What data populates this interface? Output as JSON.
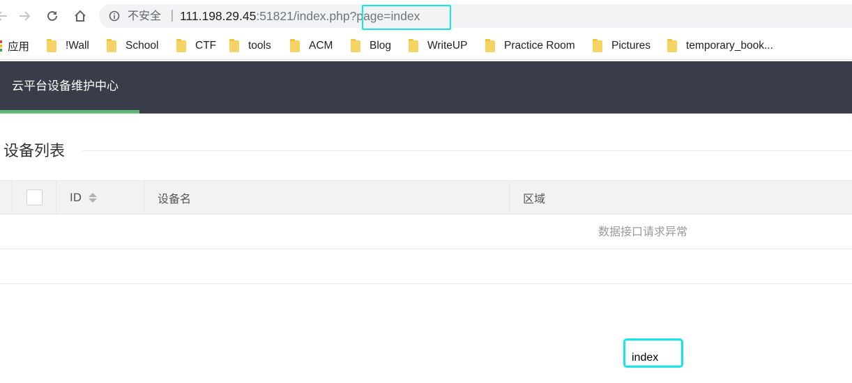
{
  "browser": {
    "security_label": "不安全",
    "url_separator": "|",
    "url_host": "111.198.29.45",
    "url_rest": ":51821/index.php?page=index"
  },
  "bookmarks": {
    "apps_label": "应用",
    "items": [
      {
        "label": "!Wall",
        "icon": "folder-icon"
      },
      {
        "label": "School",
        "icon": "folder-icon"
      },
      {
        "label": "CTF",
        "icon": "folder-icon"
      },
      {
        "label": "tools",
        "icon": "folder-icon"
      },
      {
        "label": "ACM",
        "icon": "folder-icon"
      },
      {
        "label": "Blog",
        "icon": "folder-icon"
      },
      {
        "label": "WriteUP",
        "icon": "folder-icon"
      },
      {
        "label": "Practice Room",
        "icon": "folder-icon"
      },
      {
        "label": "Pictures",
        "icon": "folder-icon"
      },
      {
        "label": "temporary_book...",
        "icon": "folder-icon"
      }
    ]
  },
  "app": {
    "title": "云平台设备维护中心",
    "header_bg": "#393d49",
    "accent": "#5fb878"
  },
  "main": {
    "section_title": "设备列表",
    "table": {
      "columns": [
        "ID",
        "设备名",
        "区域"
      ],
      "empty_message": "数据接口请求异常"
    },
    "output_text": "index"
  },
  "annotation_color": "#10e8ea"
}
